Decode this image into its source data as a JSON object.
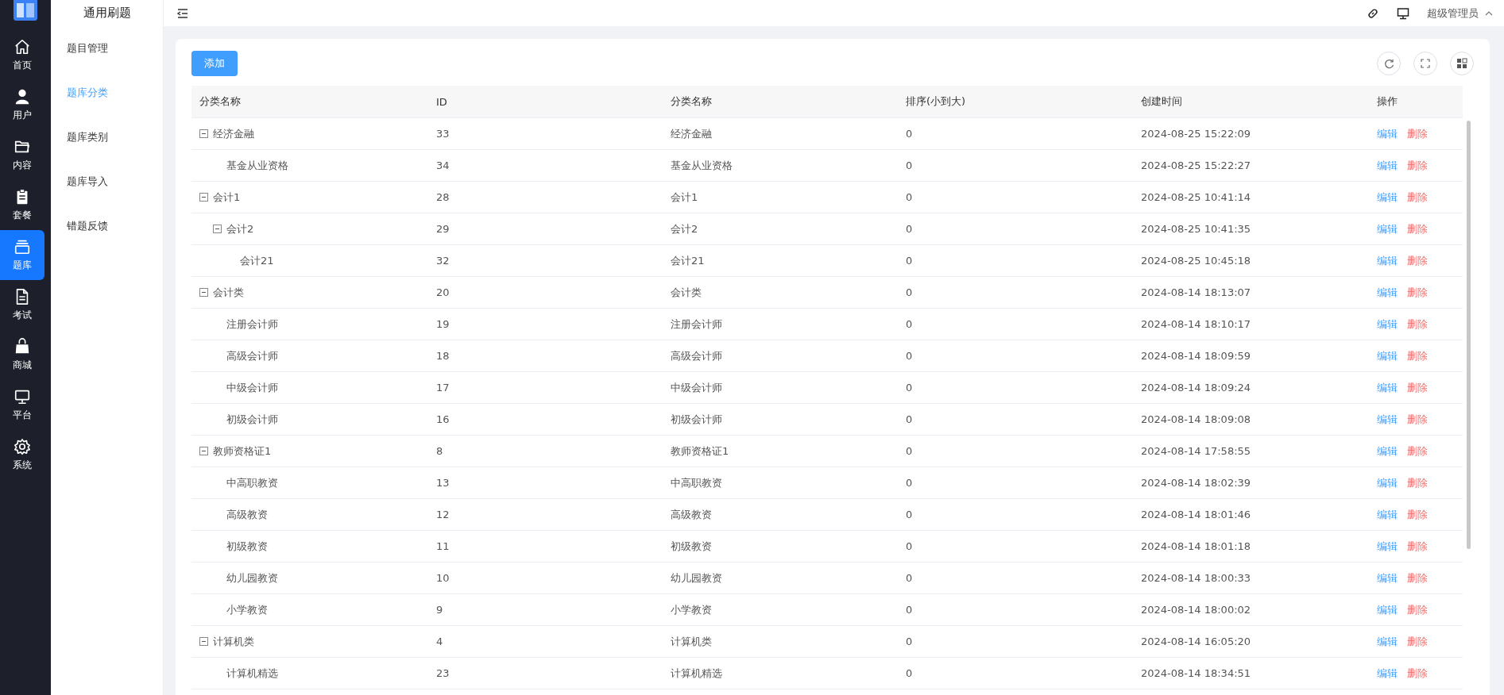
{
  "app": {
    "title": "通用刷题"
  },
  "nav": [
    {
      "label": "首页",
      "selected": false
    },
    {
      "label": "用户",
      "selected": false
    },
    {
      "label": "内容",
      "selected": false
    },
    {
      "label": "套餐",
      "selected": false
    },
    {
      "label": "题库",
      "selected": true
    },
    {
      "label": "考试",
      "selected": false
    },
    {
      "label": "商城",
      "selected": false
    },
    {
      "label": "平台",
      "selected": false
    },
    {
      "label": "系统",
      "selected": false
    }
  ],
  "submenu": [
    {
      "label": "题目管理",
      "selected": false
    },
    {
      "label": "题库分类",
      "selected": true
    },
    {
      "label": "题库类别",
      "selected": false
    },
    {
      "label": "题库导入",
      "selected": false
    },
    {
      "label": "错题反馈",
      "selected": false
    }
  ],
  "topbar": {
    "user": "超级管理员"
  },
  "toolbar": {
    "add_button": "添加"
  },
  "table": {
    "columns": [
      "分类名称",
      "ID",
      "分类名称",
      "排序(小到大)",
      "创建时间",
      "操作"
    ],
    "rows": [
      {
        "name": "经济金融",
        "id": "33",
        "category": "经济金融",
        "sort": "0",
        "created": "2024-08-25 15:22:09",
        "actions": [
          {
            "kind": "edit",
            "label": "编辑"
          },
          {
            "kind": "delete",
            "label": "删除"
          }
        ],
        "expanded": true,
        "children": [
          {
            "name": "基金从业资格",
            "id": "34",
            "category": "基金从业资格",
            "sort": "0",
            "created": "2024-08-25 15:22:27",
            "actions": [
              {
                "kind": "edit",
                "label": "编辑"
              },
              {
                "kind": "delete",
                "label": "删除"
              }
            ]
          }
        ]
      },
      {
        "name": "会计1",
        "id": "28",
        "category": "会计1",
        "sort": "0",
        "created": "2024-08-25 10:41:14",
        "actions": [
          {
            "kind": "edit",
            "label": "编辑"
          },
          {
            "kind": "delete",
            "label": "删除"
          }
        ],
        "expanded": true,
        "children": [
          {
            "name": "会计2",
            "id": "29",
            "category": "会计2",
            "sort": "0",
            "created": "2024-08-25 10:41:35",
            "actions": [
              {
                "kind": "edit",
                "label": "编辑"
              },
              {
                "kind": "delete",
                "label": "删除"
              }
            ],
            "expanded": true,
            "children": [
              {
                "name": "会计21",
                "id": "32",
                "category": "会计21",
                "sort": "0",
                "created": "2024-08-25 10:45:18",
                "actions": [
                  {
                    "kind": "edit",
                    "label": "编辑"
                  },
                  {
                    "kind": "delete",
                    "label": "删除"
                  }
                ]
              }
            ]
          }
        ]
      },
      {
        "name": "会计类",
        "id": "20",
        "category": "会计类",
        "sort": "0",
        "created": "2024-08-14 18:13:07",
        "actions": [
          {
            "kind": "edit",
            "label": "编辑"
          },
          {
            "kind": "delete",
            "label": "删除"
          }
        ],
        "expanded": true,
        "children": [
          {
            "name": "注册会计师",
            "id": "19",
            "category": "注册会计师",
            "sort": "0",
            "created": "2024-08-14 18:10:17",
            "actions": [
              {
                "kind": "edit",
                "label": "编辑"
              },
              {
                "kind": "delete",
                "label": "删除"
              }
            ]
          },
          {
            "name": "高级会计师",
            "id": "18",
            "category": "高级会计师",
            "sort": "0",
            "created": "2024-08-14 18:09:59",
            "actions": [
              {
                "kind": "edit",
                "label": "编辑"
              },
              {
                "kind": "delete",
                "label": "删除"
              }
            ]
          },
          {
            "name": "中级会计师",
            "id": "17",
            "category": "中级会计师",
            "sort": "0",
            "created": "2024-08-14 18:09:24",
            "actions": [
              {
                "kind": "edit",
                "label": "编辑"
              },
              {
                "kind": "delete",
                "label": "删除"
              }
            ]
          },
          {
            "name": "初级会计师",
            "id": "16",
            "category": "初级会计师",
            "sort": "0",
            "created": "2024-08-14 18:09:08",
            "actions": [
              {
                "kind": "edit",
                "label": "编辑"
              },
              {
                "kind": "delete",
                "label": "删除"
              }
            ]
          }
        ]
      },
      {
        "name": "教师资格证1",
        "id": "8",
        "category": "教师资格证1",
        "sort": "0",
        "created": "2024-08-14 17:58:55",
        "actions": [
          {
            "kind": "edit",
            "label": "编辑"
          },
          {
            "kind": "delete",
            "label": "删除"
          }
        ],
        "expanded": true,
        "children": [
          {
            "name": "中高职教资",
            "id": "13",
            "category": "中高职教资",
            "sort": "0",
            "created": "2024-08-14 18:02:39",
            "actions": [
              {
                "kind": "edit",
                "label": "编辑"
              },
              {
                "kind": "delete",
                "label": "删除"
              }
            ]
          },
          {
            "name": "高级教资",
            "id": "12",
            "category": "高级教资",
            "sort": "0",
            "created": "2024-08-14 18:01:46",
            "actions": [
              {
                "kind": "edit",
                "label": "编辑"
              },
              {
                "kind": "delete",
                "label": "删除"
              }
            ]
          },
          {
            "name": "初级教资",
            "id": "11",
            "category": "初级教资",
            "sort": "0",
            "created": "2024-08-14 18:01:18",
            "actions": [
              {
                "kind": "edit",
                "label": "编辑"
              },
              {
                "kind": "delete",
                "label": "删除"
              }
            ]
          },
          {
            "name": "幼儿园教资",
            "id": "10",
            "category": "幼儿园教资",
            "sort": "0",
            "created": "2024-08-14 18:00:33",
            "actions": [
              {
                "kind": "edit",
                "label": "编辑"
              },
              {
                "kind": "delete",
                "label": "删除"
              }
            ]
          },
          {
            "name": "小学教资",
            "id": "9",
            "category": "小学教资",
            "sort": "0",
            "created": "2024-08-14 18:00:02",
            "actions": [
              {
                "kind": "edit",
                "label": "编辑"
              },
              {
                "kind": "delete",
                "label": "删除"
              }
            ]
          }
        ]
      },
      {
        "name": "计算机类",
        "id": "4",
        "category": "计算机类",
        "sort": "0",
        "created": "2024-08-14 16:05:20",
        "actions": [
          {
            "kind": "edit",
            "label": "编辑"
          },
          {
            "kind": "delete",
            "label": "删除"
          }
        ],
        "expanded": true,
        "children": [
          {
            "name": "计算机精选",
            "id": "23",
            "category": "计算机精选",
            "sort": "0",
            "created": "2024-08-14 18:34:51",
            "actions": [
              {
                "kind": "edit",
                "label": "编辑"
              },
              {
                "kind": "delete",
                "label": "删除"
              }
            ]
          }
        ]
      }
    ]
  }
}
